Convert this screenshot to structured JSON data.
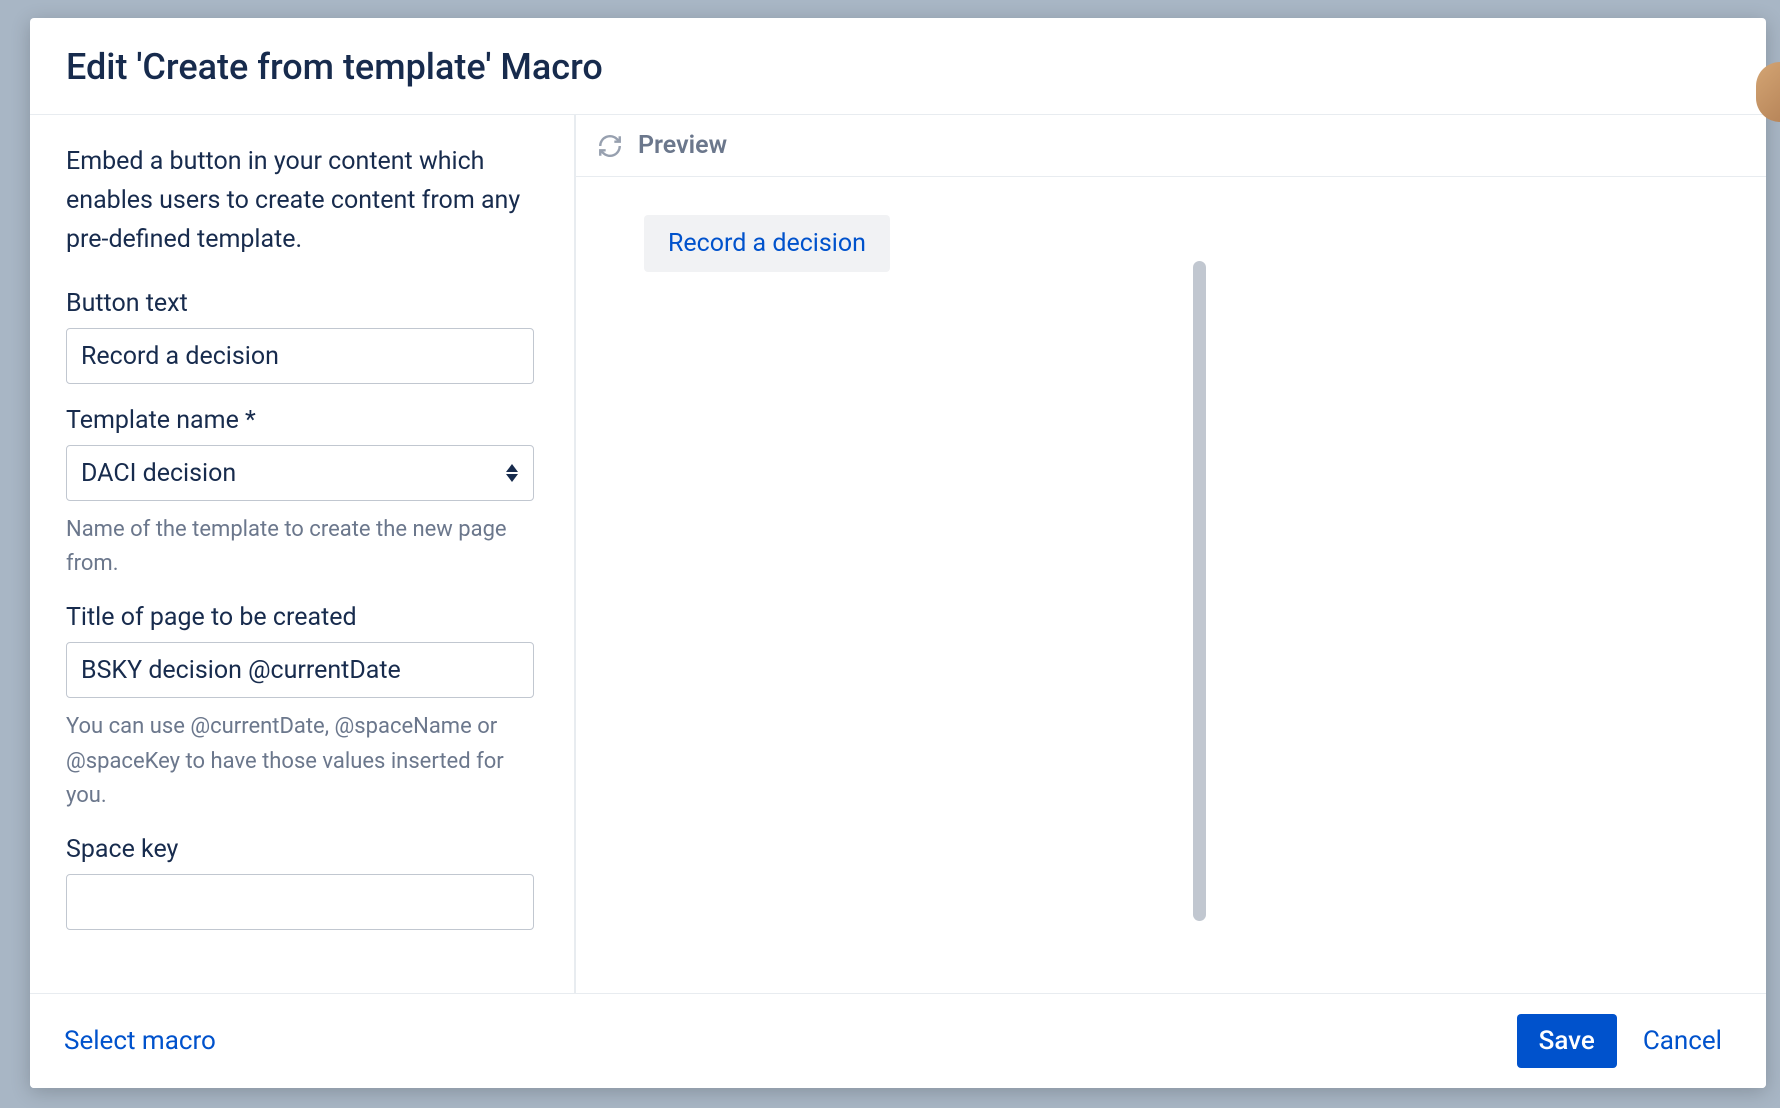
{
  "modal": {
    "title": "Edit 'Create from template' Macro"
  },
  "form": {
    "description": "Embed a button in your content which enables users to create content from any pre-defined template.",
    "button_text": {
      "label": "Button text",
      "value": "Record a decision"
    },
    "template_name": {
      "label": "Template name *",
      "value": "DACI decision",
      "hint": "Name of the template to create the new page from."
    },
    "page_title": {
      "label": "Title of page to be created",
      "value": "BSKY decision @currentDate",
      "hint": "You can use @currentDate, @spaceName or @spaceKey to have those values inserted for you."
    },
    "space_key": {
      "label": "Space key",
      "value": ""
    }
  },
  "preview": {
    "title": "Preview",
    "button_label": "Record a decision"
  },
  "footer": {
    "select_macro": "Select macro",
    "save": "Save",
    "cancel": "Cancel"
  }
}
